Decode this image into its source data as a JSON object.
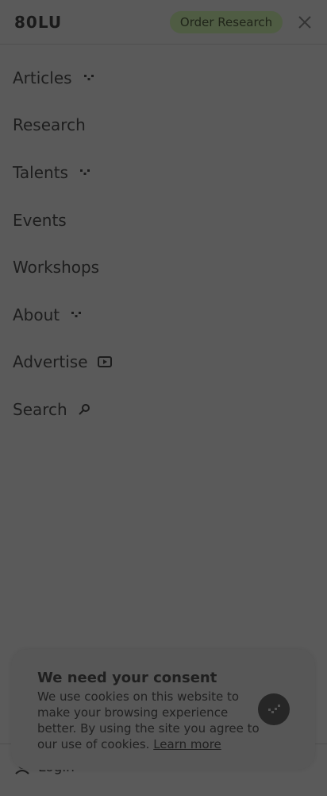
{
  "header": {
    "logo": "80LU",
    "order_button": "Order Research"
  },
  "nav": {
    "items": [
      {
        "label": "Articles",
        "icon": "chevron-down-icon"
      },
      {
        "label": "Research",
        "icon": ""
      },
      {
        "label": "Talents",
        "icon": "chevron-down-icon"
      },
      {
        "label": "Events",
        "icon": ""
      },
      {
        "label": "Workshops",
        "icon": ""
      },
      {
        "label": "About",
        "icon": "chevron-down-icon"
      },
      {
        "label": "Advertise",
        "icon": "play-icon"
      },
      {
        "label": "Search",
        "icon": "search-icon"
      }
    ]
  },
  "footer": {
    "login": "Login"
  },
  "consent": {
    "title": "We need your consent",
    "text_before_link": "We use cookies on this website to make your browsing experience better. By using the site you agree to our use of cookies.",
    "link": "Learn more"
  }
}
